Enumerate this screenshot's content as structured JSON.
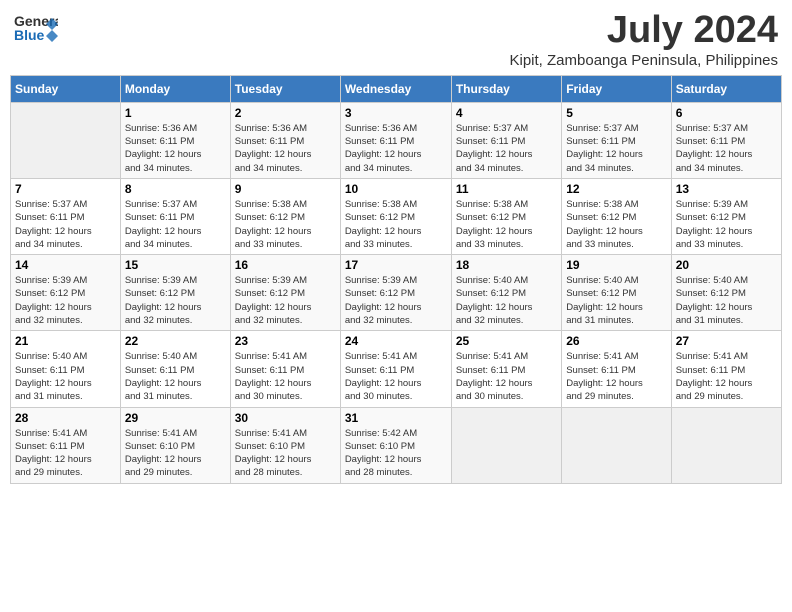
{
  "header": {
    "logo_line1": "General",
    "logo_line2": "Blue",
    "month": "July 2024",
    "location": "Kipit, Zamboanga Peninsula, Philippines"
  },
  "days_of_week": [
    "Sunday",
    "Monday",
    "Tuesday",
    "Wednesday",
    "Thursday",
    "Friday",
    "Saturday"
  ],
  "weeks": [
    [
      {
        "day": "",
        "info": ""
      },
      {
        "day": "1",
        "info": "Sunrise: 5:36 AM\nSunset: 6:11 PM\nDaylight: 12 hours\nand 34 minutes."
      },
      {
        "day": "2",
        "info": "Sunrise: 5:36 AM\nSunset: 6:11 PM\nDaylight: 12 hours\nand 34 minutes."
      },
      {
        "day": "3",
        "info": "Sunrise: 5:36 AM\nSunset: 6:11 PM\nDaylight: 12 hours\nand 34 minutes."
      },
      {
        "day": "4",
        "info": "Sunrise: 5:37 AM\nSunset: 6:11 PM\nDaylight: 12 hours\nand 34 minutes."
      },
      {
        "day": "5",
        "info": "Sunrise: 5:37 AM\nSunset: 6:11 PM\nDaylight: 12 hours\nand 34 minutes."
      },
      {
        "day": "6",
        "info": "Sunrise: 5:37 AM\nSunset: 6:11 PM\nDaylight: 12 hours\nand 34 minutes."
      }
    ],
    [
      {
        "day": "7",
        "info": "Sunrise: 5:37 AM\nSunset: 6:11 PM\nDaylight: 12 hours\nand 34 minutes."
      },
      {
        "day": "8",
        "info": "Sunrise: 5:37 AM\nSunset: 6:11 PM\nDaylight: 12 hours\nand 34 minutes."
      },
      {
        "day": "9",
        "info": "Sunrise: 5:38 AM\nSunset: 6:12 PM\nDaylight: 12 hours\nand 33 minutes."
      },
      {
        "day": "10",
        "info": "Sunrise: 5:38 AM\nSunset: 6:12 PM\nDaylight: 12 hours\nand 33 minutes."
      },
      {
        "day": "11",
        "info": "Sunrise: 5:38 AM\nSunset: 6:12 PM\nDaylight: 12 hours\nand 33 minutes."
      },
      {
        "day": "12",
        "info": "Sunrise: 5:38 AM\nSunset: 6:12 PM\nDaylight: 12 hours\nand 33 minutes."
      },
      {
        "day": "13",
        "info": "Sunrise: 5:39 AM\nSunset: 6:12 PM\nDaylight: 12 hours\nand 33 minutes."
      }
    ],
    [
      {
        "day": "14",
        "info": "Sunrise: 5:39 AM\nSunset: 6:12 PM\nDaylight: 12 hours\nand 32 minutes."
      },
      {
        "day": "15",
        "info": "Sunrise: 5:39 AM\nSunset: 6:12 PM\nDaylight: 12 hours\nand 32 minutes."
      },
      {
        "day": "16",
        "info": "Sunrise: 5:39 AM\nSunset: 6:12 PM\nDaylight: 12 hours\nand 32 minutes."
      },
      {
        "day": "17",
        "info": "Sunrise: 5:39 AM\nSunset: 6:12 PM\nDaylight: 12 hours\nand 32 minutes."
      },
      {
        "day": "18",
        "info": "Sunrise: 5:40 AM\nSunset: 6:12 PM\nDaylight: 12 hours\nand 32 minutes."
      },
      {
        "day": "19",
        "info": "Sunrise: 5:40 AM\nSunset: 6:12 PM\nDaylight: 12 hours\nand 31 minutes."
      },
      {
        "day": "20",
        "info": "Sunrise: 5:40 AM\nSunset: 6:12 PM\nDaylight: 12 hours\nand 31 minutes."
      }
    ],
    [
      {
        "day": "21",
        "info": "Sunrise: 5:40 AM\nSunset: 6:11 PM\nDaylight: 12 hours\nand 31 minutes."
      },
      {
        "day": "22",
        "info": "Sunrise: 5:40 AM\nSunset: 6:11 PM\nDaylight: 12 hours\nand 31 minutes."
      },
      {
        "day": "23",
        "info": "Sunrise: 5:41 AM\nSunset: 6:11 PM\nDaylight: 12 hours\nand 30 minutes."
      },
      {
        "day": "24",
        "info": "Sunrise: 5:41 AM\nSunset: 6:11 PM\nDaylight: 12 hours\nand 30 minutes."
      },
      {
        "day": "25",
        "info": "Sunrise: 5:41 AM\nSunset: 6:11 PM\nDaylight: 12 hours\nand 30 minutes."
      },
      {
        "day": "26",
        "info": "Sunrise: 5:41 AM\nSunset: 6:11 PM\nDaylight: 12 hours\nand 29 minutes."
      },
      {
        "day": "27",
        "info": "Sunrise: 5:41 AM\nSunset: 6:11 PM\nDaylight: 12 hours\nand 29 minutes."
      }
    ],
    [
      {
        "day": "28",
        "info": "Sunrise: 5:41 AM\nSunset: 6:11 PM\nDaylight: 12 hours\nand 29 minutes."
      },
      {
        "day": "29",
        "info": "Sunrise: 5:41 AM\nSunset: 6:10 PM\nDaylight: 12 hours\nand 29 minutes."
      },
      {
        "day": "30",
        "info": "Sunrise: 5:41 AM\nSunset: 6:10 PM\nDaylight: 12 hours\nand 28 minutes."
      },
      {
        "day": "31",
        "info": "Sunrise: 5:42 AM\nSunset: 6:10 PM\nDaylight: 12 hours\nand 28 minutes."
      },
      {
        "day": "",
        "info": ""
      },
      {
        "day": "",
        "info": ""
      },
      {
        "day": "",
        "info": ""
      }
    ]
  ]
}
